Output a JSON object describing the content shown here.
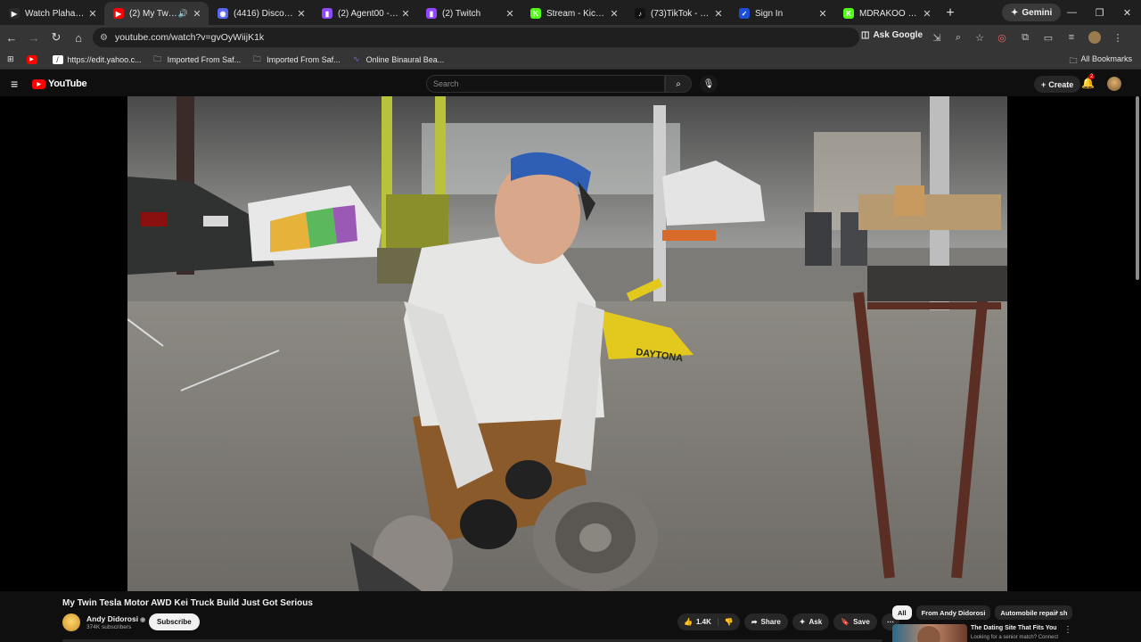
{
  "tabs": [
    {
      "title": "Watch Plaha full HD",
      "fav_color": "#2b2b2b",
      "fav_glyph": "▶",
      "icon": "play-icon"
    },
    {
      "title": "(2) My Twin Tesla",
      "fav_color": "#ff0000",
      "fav_glyph": "▶",
      "icon": "youtube-icon",
      "active": true,
      "audio": true
    },
    {
      "title": "(4416) Discord | #",
      "fav_color": "#5865f2",
      "fav_glyph": "◉",
      "icon": "discord-icon"
    },
    {
      "title": "(2) Agent00 - Twitch",
      "fav_color": "#9146ff",
      "fav_glyph": "▮",
      "icon": "twitch-icon"
    },
    {
      "title": "(2) Twitch",
      "fav_color": "#9146ff",
      "fav_glyph": "▮",
      "icon": "twitch-icon"
    },
    {
      "title": "Stream - Kick Dashb",
      "fav_color": "#53fc18",
      "fav_glyph": "K",
      "icon": "kick-icon"
    },
    {
      "title": "(73)TikTok - Make Yo",
      "fav_color": "#111111",
      "fav_glyph": "♪",
      "icon": "tiktok-icon"
    },
    {
      "title": "Sign In",
      "fav_color": "#1d4ed8",
      "fav_glyph": "✓",
      "icon": "signin-icon"
    },
    {
      "title": "MDRAKOO Stream",
      "fav_color": "#53fc18",
      "fav_glyph": "K",
      "icon": "kick-icon"
    }
  ],
  "gemini_label": "Gemini",
  "address": {
    "url": "youtube.com/watch?v=gvOyWiijK1k",
    "ask_google": "Ask Google"
  },
  "bookmarks": [
    {
      "label": "",
      "icon": "youtube-icon",
      "color": "#ff0000"
    },
    {
      "label": "https://edit.yahoo.c...",
      "icon": "yahoo-icon",
      "color": "#ffffff"
    },
    {
      "label": "Imported From Saf...",
      "icon": "folder-icon",
      "color": "#cccccc"
    },
    {
      "label": "Imported From Saf...",
      "icon": "folder-icon",
      "color": "#cccccc"
    },
    {
      "label": "Online Binaural Bea...",
      "icon": "wave-icon",
      "color": "#7c5cff"
    }
  ],
  "all_bookmarks": "All Bookmarks",
  "yt": {
    "logo": "YouTube",
    "search_placeholder": "Search",
    "create": "Create",
    "notif_count": "2"
  },
  "video": {
    "title": "My Twin Tesla Motor AWD Kei Truck Build Just Got Serious",
    "channel": "Andy Didorosi",
    "subscribers": "374K subscribers",
    "subscribe": "Subscribe",
    "likes": "1.4K",
    "share": "Share",
    "ask": "Ask",
    "save": "Save",
    "jack_text": "DAYTONA"
  },
  "chips": [
    "All",
    "From Andy Didorosi",
    "Automobile repair sh"
  ],
  "recommendation": {
    "title": "The Dating Site That Fits You",
    "subtitle": "Looking for a senior match? Connect"
  }
}
